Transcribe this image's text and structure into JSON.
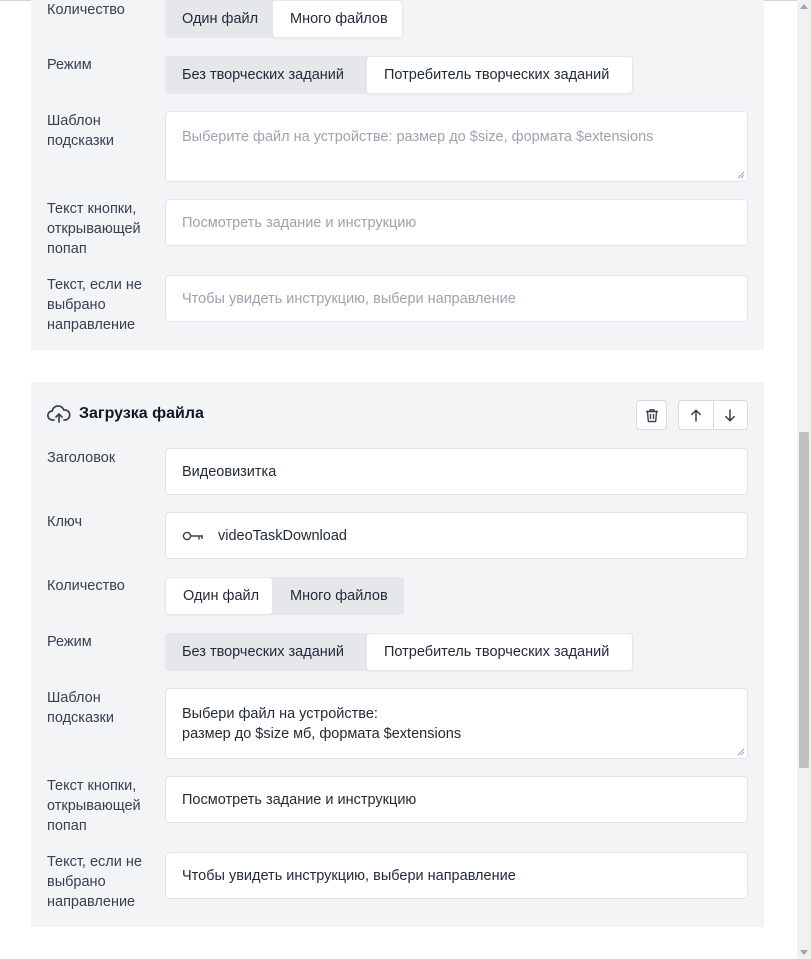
{
  "section1": {
    "quantity_label": "Количество",
    "quantity_options": [
      "Один файл",
      "Много файлов"
    ],
    "quantity_selected": "Много файлов",
    "mode_label": "Режим",
    "mode_options": [
      "Без творческих заданий",
      "Потребитель творческих заданий"
    ],
    "mode_selected": "Потребитель творческих заданий",
    "hint_label": "Шаблон\nподсказки",
    "hint_placeholder": "Выберите файл на устройстве: размер до $size, формата $extensions",
    "button_text_label": "Текст кнопки,\nоткрывающей\nпопап",
    "button_text_placeholder": "Посмотреть задание и инструкцию",
    "no_direction_label": "Текст, если не\nвыбрано\nнаправление",
    "no_direction_placeholder": "Чтобы увидеть инструкцию, выбери направление"
  },
  "section2": {
    "title": "Загрузка файла",
    "header_label": "Заголовок",
    "header_value": "Видеовизитка",
    "key_label": "Ключ",
    "key_value": "videoTaskDownload",
    "quantity_label": "Количество",
    "quantity_options": [
      "Один файл",
      "Много файлов"
    ],
    "quantity_selected": "Один файл",
    "mode_label": "Режим",
    "mode_options": [
      "Без творческих заданий",
      "Потребитель творческих заданий"
    ],
    "mode_selected": "Потребитель творческих заданий",
    "hint_label": "Шаблон\nподсказки",
    "hint_value": "Выбери файл на устройстве:\nразмер до $size мб, формата $extensions",
    "button_text_label": "Текст кнопки,\nоткрывающей\nпопап",
    "button_text_value": "Посмотреть задание и инструкцию",
    "no_direction_label": "Текст, если не\nвыбрано\nнаправление",
    "no_direction_value": "Чтобы увидеть инструкцию, выбери направление"
  },
  "icons": {
    "upload": "cloud-upload-icon",
    "trash": "trash-icon",
    "up": "arrow-up-icon",
    "down": "arrow-down-icon",
    "key": "key-icon"
  },
  "colors": {
    "panel_bg": "#f3f4f6",
    "segment_bg": "#e5e7eb",
    "border": "#e2e4ea",
    "placeholder": "#9ca3af"
  }
}
